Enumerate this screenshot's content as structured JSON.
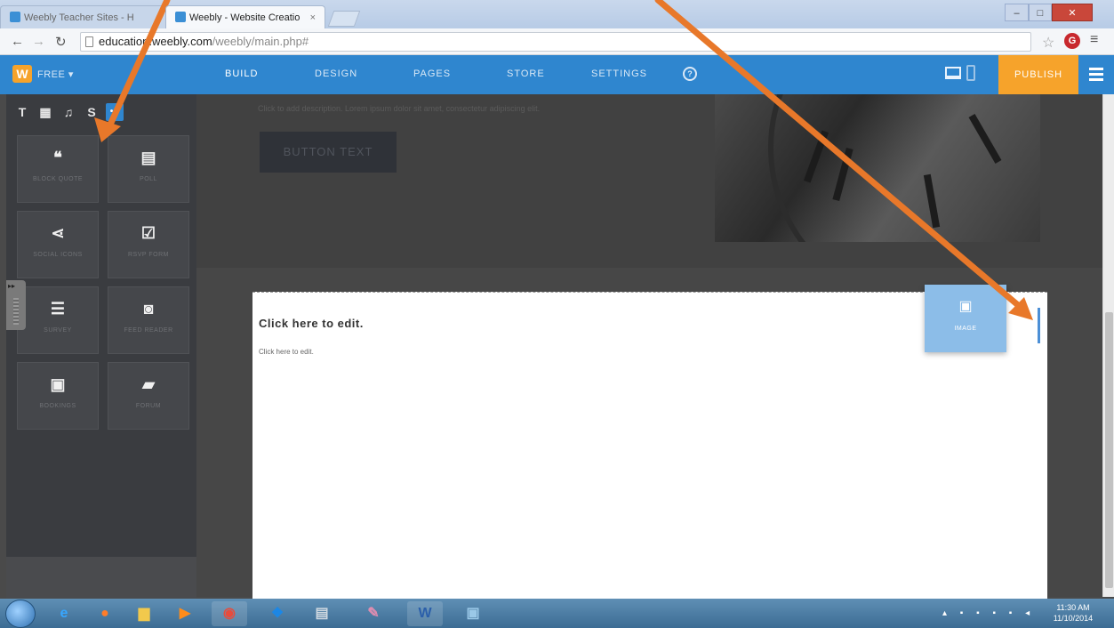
{
  "browser": {
    "tabs": [
      {
        "label": "Weebly Teacher Sites - H",
        "active": false
      },
      {
        "label": "Weebly - Website Creatio",
        "active": true
      }
    ],
    "url_host": "education.weebly.com",
    "url_path": "/weebly/main.php#",
    "extension_label": "G"
  },
  "weebly": {
    "logo_letter": "W",
    "plan": "FREE ▾",
    "nav": [
      "BUILD",
      "DESIGN",
      "PAGES",
      "STORE",
      "SETTINGS"
    ],
    "help_glyph": "?",
    "publish": "PUBLISH"
  },
  "sidebar": {
    "tabs": [
      "T",
      "▦",
      "♫",
      "S",
      "•••"
    ],
    "elements": [
      {
        "label": "Block Quote",
        "glyph": "❝"
      },
      {
        "label": "Poll",
        "glyph": "▤"
      },
      {
        "label": "Social Icons",
        "glyph": "⋖"
      },
      {
        "label": "RSVP Form",
        "glyph": "☑"
      },
      {
        "label": "Survey",
        "glyph": "☰"
      },
      {
        "label": "Feed Reader",
        "glyph": "◙"
      },
      {
        "label": "Bookings",
        "glyph": "▣"
      },
      {
        "label": "Forum",
        "glyph": "▰"
      }
    ]
  },
  "editor": {
    "description": "Click to add description. Lorem ipsum dolor sit amet, consectetur adipiscing elit.",
    "button_text": "BUTTON TEXT",
    "section_title": "Click here to edit.",
    "section_body": "Click here to edit.",
    "drag_ghost": {
      "label": "Image",
      "glyph": "▣"
    }
  },
  "taskbar": {
    "clock_time": "11:30 AM",
    "clock_date": "11/10/2014"
  },
  "colors": {
    "accent": "#2f86cf",
    "publish": "#f6a32b",
    "arrow": "#e8782a"
  }
}
